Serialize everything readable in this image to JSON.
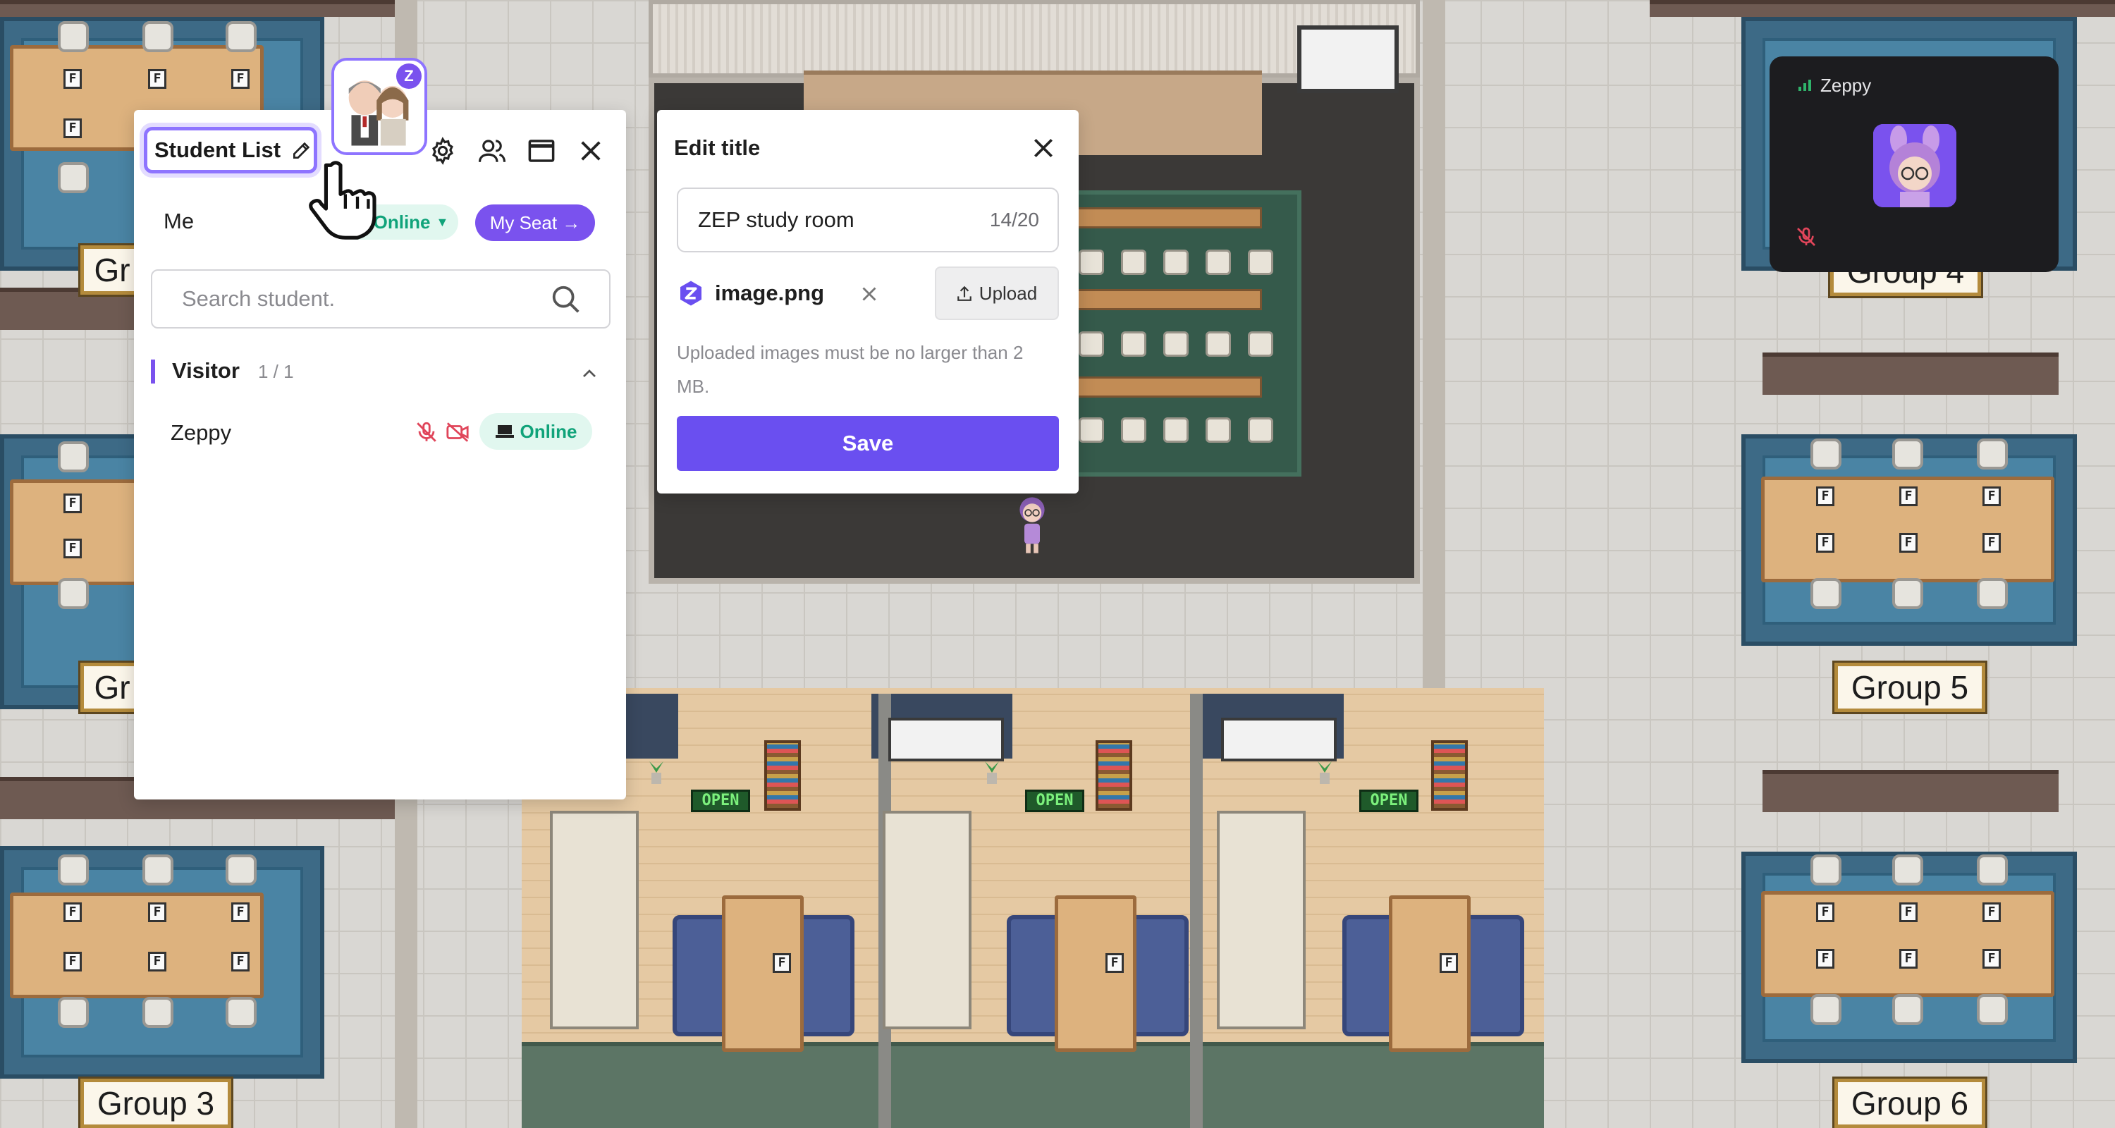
{
  "map": {
    "group_signs": {
      "left_top_partial": "Gr",
      "left_mid_partial": "Gr",
      "group3": "Group 3",
      "group4_partial": "Group 4",
      "group5": "Group 5",
      "group6": "Group 6"
    },
    "open_sign": "OPEN",
    "f_label": "F"
  },
  "student_panel": {
    "title": "Student List",
    "me_label": "Me",
    "my_status": "Online",
    "my_seat_label": "My Seat →",
    "search_placeholder": "Search student.",
    "section": {
      "title": "Visitor",
      "count": "1 / 1"
    },
    "users": [
      {
        "name": "Zeppy",
        "status": "Online"
      }
    ],
    "profile_badge_letter": "Z"
  },
  "edit_dialog": {
    "title": "Edit title",
    "input_value": "ZEP study room",
    "counter": "14/20",
    "file_name": "image.png",
    "upload_label": "Upload",
    "hint": "Uploaded images must be no larger than 2 MB.",
    "save_label": "Save"
  },
  "video_tile": {
    "name": "Zeppy"
  },
  "colors": {
    "accent": "#7a52ee",
    "save_button": "#6a4ff0",
    "online_text": "#10a37a",
    "online_bg": "#e1f7ef",
    "mic_off": "#e0455a"
  }
}
